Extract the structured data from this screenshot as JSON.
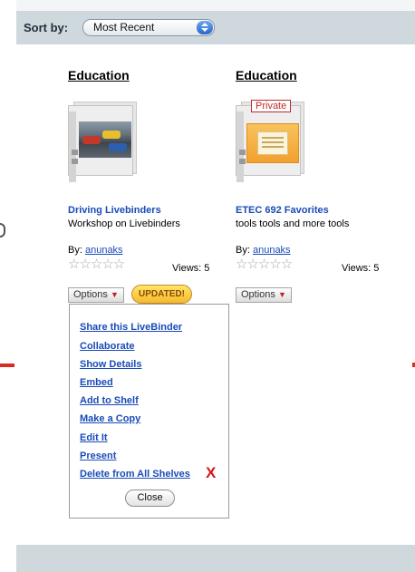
{
  "sort": {
    "label": "Sort by:",
    "selected": "Most Recent"
  },
  "cards": [
    {
      "shelf": "Education",
      "title": "Driving Livebinders",
      "description": "Workshop on Livebinders",
      "by_label": "By:",
      "author": "anunaks",
      "rating": "☆☆☆☆☆",
      "views": "Views: 5",
      "options_label": "Options",
      "updated_badge": "UPDATED!",
      "thumbnail": "race-cars-binder-icon"
    },
    {
      "shelf": "Education",
      "title": "ETEC 692 Favorites",
      "description": "tools tools and more tools",
      "by_label": "By:",
      "author": "anunaks",
      "rating": "☆☆☆☆☆",
      "views": "Views: 5",
      "options_label": "Options",
      "private_badge": "Private",
      "thumbnail": "orange-document-binder-icon"
    }
  ],
  "options_menu": {
    "items": [
      "Share this LiveBinder",
      "Collaborate",
      "Show Details",
      "Embed",
      "Add to Shelf",
      "Make a Copy",
      "Edit It",
      "Present",
      "Delete from All Shelves"
    ],
    "delete_mark": "X",
    "close_label": "Close"
  },
  "colors": {
    "link": "#1a4bb8",
    "bar": "#cfd8dc",
    "delete": "#d3141c",
    "updated": "#f6b92a"
  }
}
